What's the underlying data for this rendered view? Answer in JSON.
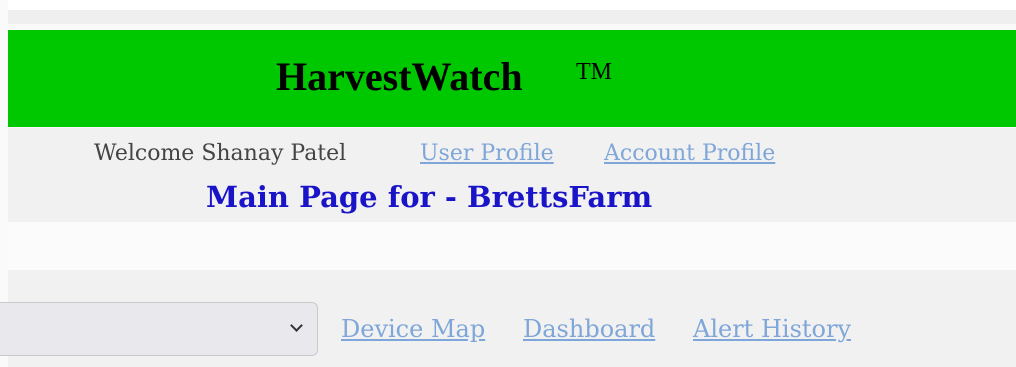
{
  "header": {
    "app_title": "HarvestWatch",
    "trademark": "TM",
    "brand_color": "#00c800"
  },
  "user_bar": {
    "welcome": "Welcome Shanay Patel",
    "links": [
      {
        "label": "User Profile"
      },
      {
        "label": "Account Profile"
      }
    ]
  },
  "main": {
    "title": "Main Page for - BrettsFarm",
    "title_color": "#1a14c8"
  },
  "nav": {
    "device_select": {
      "value": "",
      "icon": "chevron-down-icon"
    },
    "links": [
      {
        "label": "Device Map"
      },
      {
        "label": "Dashboard"
      },
      {
        "label": "Alert History"
      }
    ],
    "link_color": "#7fa6d8"
  }
}
